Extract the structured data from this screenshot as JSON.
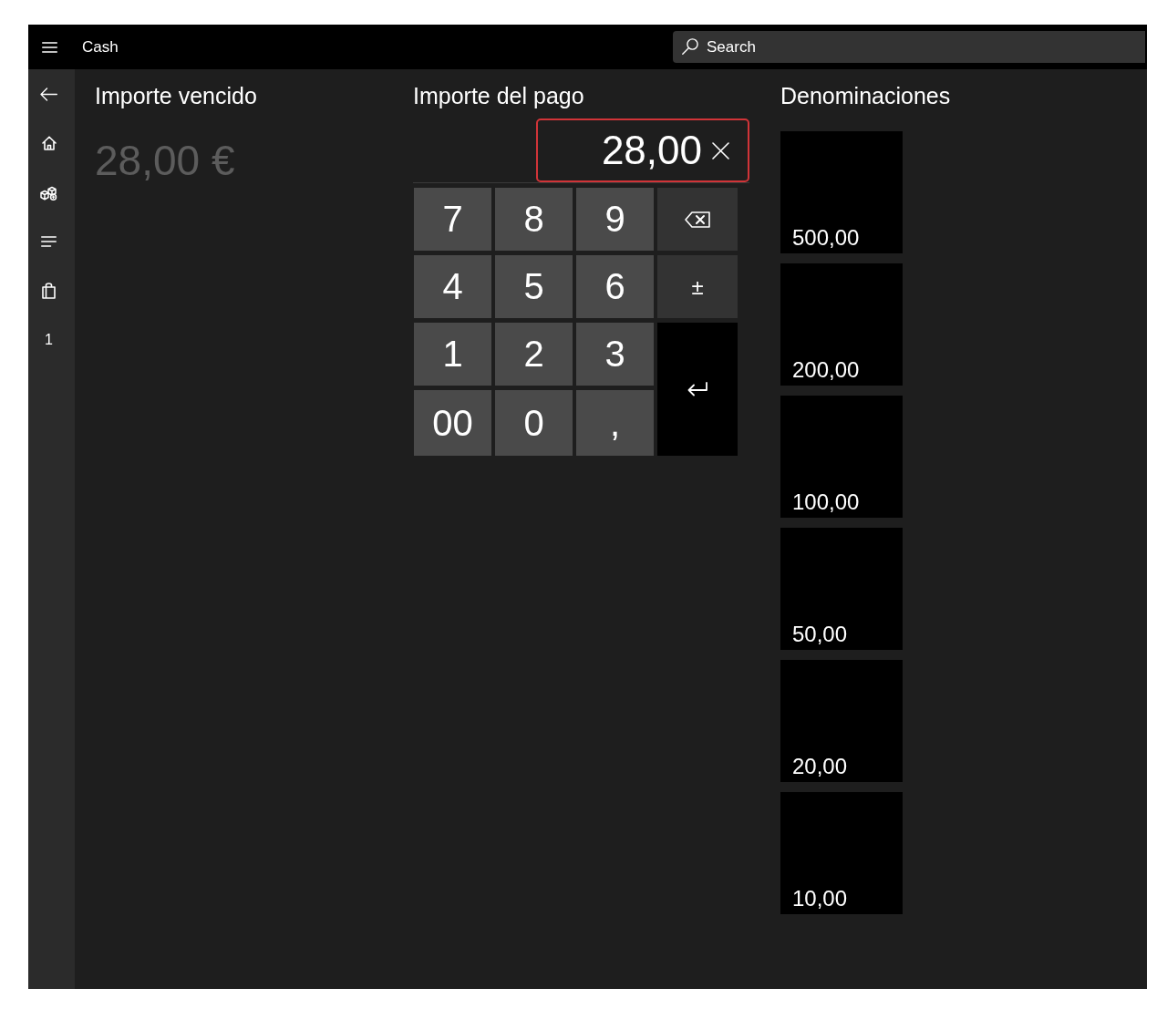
{
  "title_bar": {
    "title": "Cash",
    "search": {
      "placeholder": "Search"
    }
  },
  "sidebar": {
    "items": [
      {
        "kind": "back"
      },
      {
        "kind": "home"
      },
      {
        "kind": "products"
      },
      {
        "kind": "list"
      },
      {
        "kind": "bag"
      },
      {
        "kind": "count",
        "label": "1"
      }
    ]
  },
  "amount_due": {
    "label": "Importe vencido",
    "value": "28,00 €"
  },
  "payment": {
    "label": "Importe del pago",
    "field": {
      "value": "28,00",
      "focused": true
    },
    "keypad": [
      {
        "kind": "digit",
        "label": "7"
      },
      {
        "kind": "digit",
        "label": "8"
      },
      {
        "kind": "digit",
        "label": "9"
      },
      {
        "kind": "backspace"
      },
      {
        "kind": "digit",
        "label": "4"
      },
      {
        "kind": "digit",
        "label": "5"
      },
      {
        "kind": "digit",
        "label": "6"
      },
      {
        "kind": "sign",
        "label": "±"
      },
      {
        "kind": "digit",
        "label": "1"
      },
      {
        "kind": "digit",
        "label": "2"
      },
      {
        "kind": "digit",
        "label": "3"
      },
      {
        "kind": "enter"
      },
      {
        "kind": "digit",
        "label": "00"
      },
      {
        "kind": "digit",
        "label": "0"
      },
      {
        "kind": "digit",
        "label": ","
      }
    ]
  },
  "denominations": {
    "title": "Denominaciones",
    "items": [
      "500,00",
      "200,00",
      "100,00",
      "50,00",
      "20,00",
      "10,00"
    ]
  }
}
